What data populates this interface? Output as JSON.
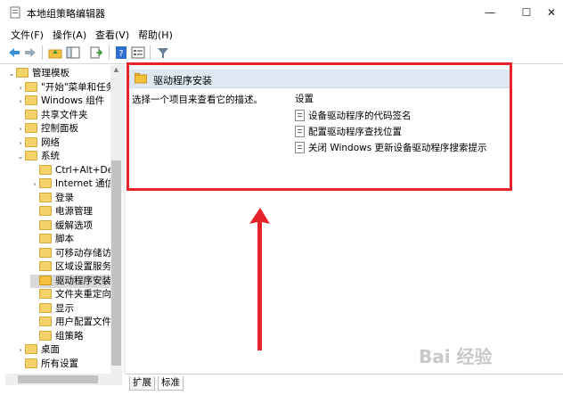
{
  "window": {
    "title": "本地组策略编辑器",
    "controls": {
      "minimize": "—",
      "maximize": "☐",
      "close": "✕"
    }
  },
  "menu": [
    "文件(F)",
    "操作(A)",
    "查看(V)",
    "帮助(H)"
  ],
  "toolbar": {
    "icons": [
      "back-icon",
      "forward-icon",
      "up-folder-icon",
      "show-tree-icon",
      "export-icon",
      "help-icon",
      "properties-icon",
      "filter-icon"
    ]
  },
  "tree": {
    "items": [
      {
        "label": "管理模板",
        "level": 0,
        "expanded": true
      },
      {
        "label": "\"开始\"菜单和任务",
        "level": 1,
        "expanded": false
      },
      {
        "label": "Windows 组件",
        "level": 1,
        "expanded": false
      },
      {
        "label": "共享文件夹",
        "level": 1
      },
      {
        "label": "控制面板",
        "level": 1,
        "expanded": false
      },
      {
        "label": "网络",
        "level": 1,
        "expanded": false
      },
      {
        "label": "系统",
        "level": 1,
        "expanded": true
      },
      {
        "label": "Ctrl+Alt+De",
        "level": 2
      },
      {
        "label": "Internet 通信",
        "level": 2,
        "expanded": false
      },
      {
        "label": "登录",
        "level": 2
      },
      {
        "label": "电源管理",
        "level": 2
      },
      {
        "label": "缓解选项",
        "level": 2
      },
      {
        "label": "脚本",
        "level": 2
      },
      {
        "label": "可移动存储访",
        "level": 2
      },
      {
        "label": "区域设置服务",
        "level": 2
      },
      {
        "label": "驱动程序安装",
        "level": 2,
        "selected": true
      },
      {
        "label": "文件夹重定向",
        "level": 2
      },
      {
        "label": "显示",
        "level": 2
      },
      {
        "label": "用户配置文件",
        "level": 2
      },
      {
        "label": "组策略",
        "level": 2
      },
      {
        "label": "桌面",
        "level": 1,
        "expanded": false
      },
      {
        "label": "所有设置",
        "level": 1
      }
    ]
  },
  "pane": {
    "title": "驱动程序安装",
    "description": "选择一个项目来查看它的描述。",
    "settings_header": "设置",
    "settings": [
      "设备驱动程序的代码签名",
      "配置驱动程序查找位置",
      "关闭 Windows 更新设备驱动程序搜索提示"
    ]
  },
  "tabs": [
    "扩展",
    "标准"
  ],
  "watermark": "Bai 经验",
  "colors": {
    "annotation": "#e8222a",
    "header": "#dde8f3"
  }
}
